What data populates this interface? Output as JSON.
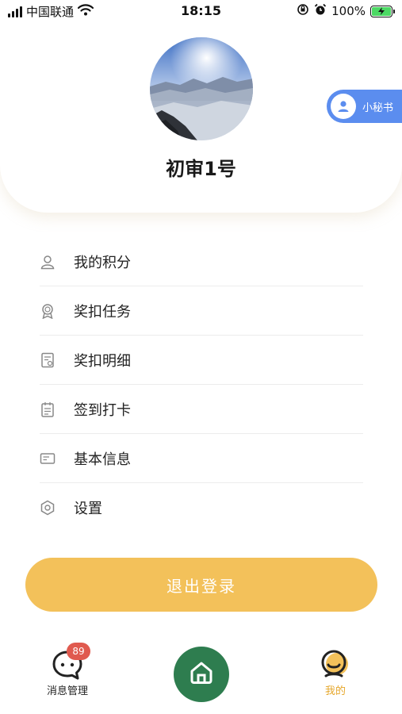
{
  "status_bar": {
    "carrier": "中国联通",
    "time": "18:15",
    "battery": "100%"
  },
  "profile": {
    "username": "初审1号"
  },
  "secretary": {
    "label": "小秘书"
  },
  "menu": {
    "items": [
      {
        "label": "我的积分",
        "icon": "user-icon"
      },
      {
        "label": "奖扣任务",
        "icon": "award-icon"
      },
      {
        "label": "奖扣明细",
        "icon": "document-icon"
      },
      {
        "label": "签到打卡",
        "icon": "calendar-icon"
      },
      {
        "label": "基本信息",
        "icon": "id-card-icon"
      },
      {
        "label": "设置",
        "icon": "settings-icon"
      }
    ]
  },
  "logout": {
    "label": "退出登录"
  },
  "nav": {
    "messages_label": "消息管理",
    "messages_badge": "89",
    "mine_label": "我的"
  },
  "colors": {
    "accent": "#f3c15a",
    "home_green": "#2e7d4f",
    "secretary_blue": "#5b8def",
    "badge_red": "#e05a4f",
    "mine_active": "#e6a72b"
  }
}
